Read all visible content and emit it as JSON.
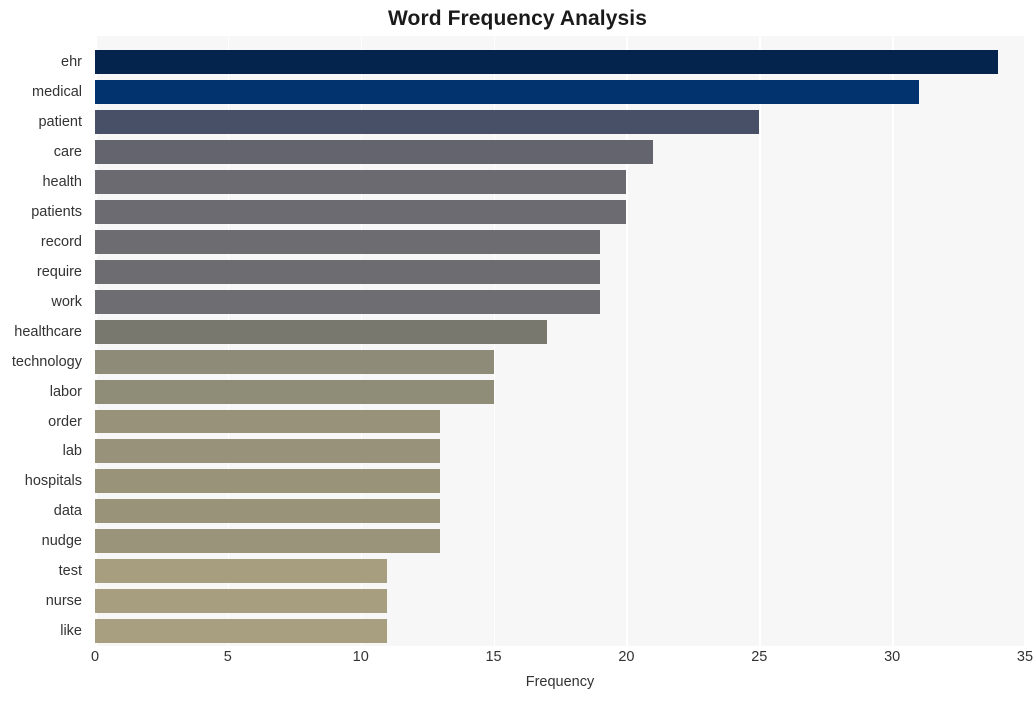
{
  "chart_data": {
    "type": "bar",
    "orientation": "horizontal",
    "title": "Word Frequency Analysis",
    "xlabel": "Frequency",
    "ylabel": "",
    "xlim": [
      0,
      35
    ],
    "ylim": null,
    "grid": true,
    "legend": null,
    "xticks": [
      "0",
      "5",
      "10",
      "15",
      "20",
      "25",
      "30",
      "35"
    ],
    "xtick_values": [
      0,
      5,
      10,
      15,
      20,
      25,
      30,
      35
    ],
    "categories": [
      "ehr",
      "medical",
      "patient",
      "care",
      "health",
      "patients",
      "record",
      "require",
      "work",
      "healthcare",
      "technology",
      "labor",
      "order",
      "lab",
      "hospitals",
      "data",
      "nudge",
      "test",
      "nurse",
      "like"
    ],
    "values": [
      34,
      31,
      25,
      21,
      20,
      20,
      19,
      19,
      19,
      17,
      15,
      15,
      13,
      13,
      13,
      13,
      13,
      11,
      11,
      11
    ],
    "bar_colors": [
      "#04244d",
      "#02336e",
      "#475066",
      "#64646f",
      "#6a6a70",
      "#6b6b71",
      "#6c6c71",
      "#6c6c71",
      "#6d6d72",
      "#79786f",
      "#8e8b78",
      "#8f8c78",
      "#98927a",
      "#98927a",
      "#99937a",
      "#99937a",
      "#9a947b",
      "#a69e7f",
      "#a69e7f",
      "#a79f80"
    ],
    "plot_background": "#f7f7f7",
    "gridline_color": "#ffffff",
    "figure_background": "#ffffff",
    "text_color": "#333333",
    "title_color": "#1a1a1a"
  }
}
